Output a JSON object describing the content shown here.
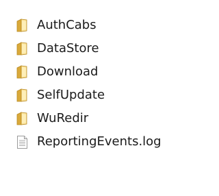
{
  "items": [
    {
      "name": "AuthCabs",
      "icon": "folder-icon",
      "kind": "folder"
    },
    {
      "name": "DataStore",
      "icon": "folder-icon",
      "kind": "folder"
    },
    {
      "name": "Download",
      "icon": "folder-icon",
      "kind": "folder"
    },
    {
      "name": "SelfUpdate",
      "icon": "folder-icon",
      "kind": "folder"
    },
    {
      "name": "WuRedir",
      "icon": "folder-icon",
      "kind": "folder"
    },
    {
      "name": "ReportingEvents.log",
      "icon": "document-icon",
      "kind": "file"
    }
  ],
  "colors": {
    "folder_light": "#fbe39a",
    "folder_dark": "#d9a93a",
    "folder_edge": "#b88a24",
    "document_fill": "#ffffff",
    "document_edge": "#9a9a9a",
    "document_lines": "#a9a9a9"
  }
}
